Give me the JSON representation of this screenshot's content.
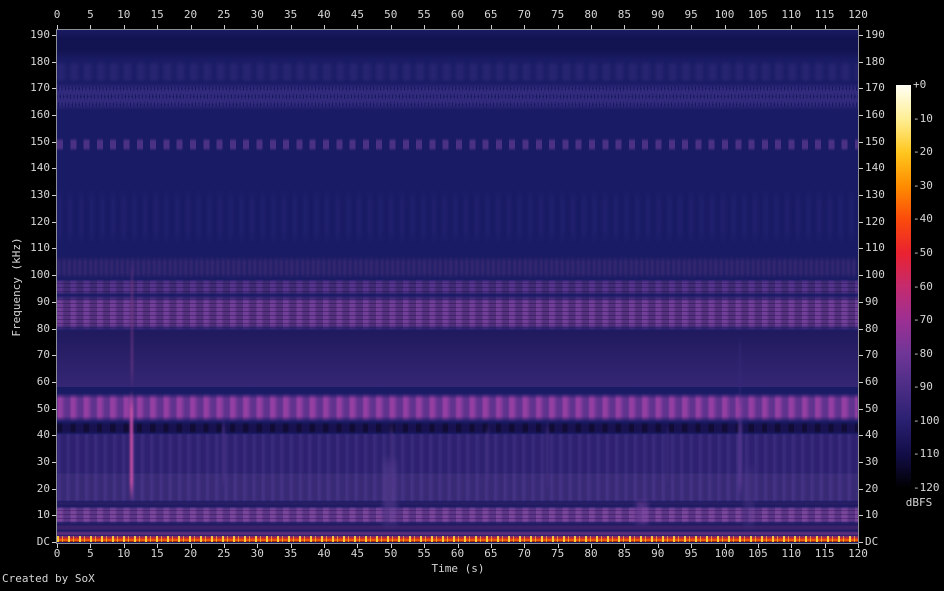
{
  "colors": {
    "page_background": "#000000",
    "plot_background": "#191b64",
    "plot_border": "#8e8e96",
    "tick": "#cfcfcf",
    "label_text": "#d6d6d6"
  },
  "chart_data": {
    "type": "heatmap",
    "subtype": "spectrogram",
    "xlabel": "Time (s)",
    "ylabel": "Frequency (kHz)",
    "credit": "Created by SoX",
    "colorbar_label": "dBFS",
    "x_range_s": [
      0,
      120
    ],
    "x_tick_step_s": 5,
    "y_range_khz": [
      0,
      192
    ],
    "y_tick_step_khz": 10,
    "colorbar_range_db": [
      0,
      -120
    ],
    "x_tick_labels": [
      "0",
      "5",
      "10",
      "15",
      "20",
      "25",
      "30",
      "35",
      "40",
      "45",
      "50",
      "55",
      "60",
      "65",
      "70",
      "75",
      "80",
      "85",
      "90",
      "95",
      "100",
      "105",
      "110",
      "115",
      "120"
    ],
    "y_tick_labels": [
      "190",
      "180",
      "170",
      "160",
      "150",
      "140",
      "130",
      "120",
      "110",
      "100",
      "90",
      "80",
      "70",
      "60",
      "50",
      "40",
      "30",
      "20",
      "10",
      "DC"
    ],
    "colorbar_tick_labels": [
      "+0",
      "-10",
      "-20",
      "-30",
      "-40",
      "-50",
      "-60",
      "-70",
      "-80",
      "-90",
      "-100",
      "-110",
      "-120"
    ],
    "palette_stops": [
      {
        "db": -120,
        "color": "#000000"
      },
      {
        "db": -110,
        "color": "#120d47"
      },
      {
        "db": -100,
        "color": "#2a2071"
      },
      {
        "db": -90,
        "color": "#4b2d85"
      },
      {
        "db": -80,
        "color": "#6f3697"
      },
      {
        "db": -70,
        "color": "#9d2f93"
      },
      {
        "db": -60,
        "color": "#c52b6e"
      },
      {
        "db": -50,
        "color": "#ea2230"
      },
      {
        "db": -40,
        "color": "#fb4b0b"
      },
      {
        "db": -30,
        "color": "#ff8d00"
      },
      {
        "db": -20,
        "color": "#ffc71f"
      },
      {
        "db": -10,
        "color": "#ffef96"
      },
      {
        "db": 0,
        "color": "#fffff5"
      }
    ],
    "bands": [
      {
        "name": "top-fade",
        "f_low": 181,
        "f_high": 192,
        "texture": "smooth",
        "colors": [
          "#12134f"
        ],
        "opacity": 0.9,
        "feather": 30
      },
      {
        "name": "mottle-175khz",
        "f_low": 171.5,
        "f_high": 180.5,
        "texture": "mottle",
        "colors": [
          "#2b2875"
        ],
        "period_s": 2,
        "opacity": 0.85,
        "feather": 25
      },
      {
        "name": "wave-167khz",
        "f_low": 162,
        "f_high": 172,
        "texture": "wave",
        "colors": [
          "#342c80",
          "#0e0e46"
        ],
        "period_s": 1,
        "opacity": 0.9,
        "feather": 20
      },
      {
        "name": "dashes-149khz",
        "f_low": 146.5,
        "f_high": 151.5,
        "texture": "dashes",
        "colors": [
          "#503488"
        ],
        "period_s": 2,
        "opacity": 0.9,
        "feather": 25
      },
      {
        "name": "faintcols-120khz",
        "f_low": 111,
        "f_high": 133,
        "texture": "faintcols",
        "colors": [
          "#262577"
        ],
        "period_s": 1.6,
        "opacity": 0.5,
        "feather": 25
      },
      {
        "name": "fuzz-103khz",
        "f_low": 98.5,
        "f_high": 107,
        "texture": "speckle",
        "colors": [
          "#3c2b73"
        ],
        "period_s": 0.8,
        "opacity": 0.85,
        "feather": 25
      },
      {
        "name": "band-96khz",
        "f_low": 92.5,
        "f_high": 98.5,
        "texture": "blocks",
        "colors": [
          "#452c78",
          "#5a3690"
        ],
        "period_s": 2,
        "opacity": 0.95,
        "feather": 20
      },
      {
        "name": "band-86khz",
        "f_low": 79,
        "f_high": 92.5,
        "texture": "blocks",
        "colors": [
          "#54307f",
          "#713e99"
        ],
        "period_s": 2,
        "opacity": 1,
        "feather": 18
      },
      {
        "name": "grad-70khz",
        "f_low": 58,
        "f_high": 79,
        "texture": "vgrad",
        "colors": [
          "#352674",
          "#201a5e"
        ],
        "opacity": 1,
        "feather": 0
      },
      {
        "name": "band-50khz",
        "f_low": 44.8,
        "f_high": 56,
        "texture": "blobs",
        "colors": [
          "#5f338e",
          "#943fa2"
        ],
        "period_s": 2,
        "opacity": 1,
        "feather": 20
      },
      {
        "name": "dark-43khz",
        "f_low": 40.3,
        "f_high": 44.8,
        "texture": "darkdash",
        "colors": [
          "#181250"
        ],
        "period_s": 2,
        "opacity": 0.95,
        "feather": 25
      },
      {
        "name": "noise-33khz",
        "f_low": 26,
        "f_high": 40.3,
        "texture": "columns",
        "colors": [
          "#2e2270",
          "#3a2b7c"
        ],
        "period_s": 1.4,
        "opacity": 1,
        "feather": 0
      },
      {
        "name": "noise-21khz",
        "f_low": 15.5,
        "f_high": 26,
        "texture": "columns",
        "colors": [
          "#382a75",
          "#443284"
        ],
        "period_s": 1.4,
        "opacity": 1,
        "feather": 0
      },
      {
        "name": "gap-14khz",
        "f_low": 13.5,
        "f_high": 15.5,
        "texture": "smooth",
        "colors": [
          "#2a1e66"
        ],
        "opacity": 1,
        "feather": 40
      },
      {
        "name": "band-10khz",
        "f_low": 6.8,
        "f_high": 13.5,
        "texture": "blocks",
        "colors": [
          "#5c3488",
          "#7a459c"
        ],
        "period_s": 2,
        "opacity": 1,
        "feather": 18
      },
      {
        "name": "purple-5khz",
        "f_low": 4.2,
        "f_high": 6.8,
        "texture": "smooth",
        "colors": [
          "#3b2269"
        ],
        "opacity": 1,
        "feather": 35
      },
      {
        "name": "glow-3khz",
        "f_low": 2.1,
        "f_high": 4.2,
        "texture": "smooth",
        "colors": [
          "#5c2d7c"
        ],
        "opacity": 1,
        "feather": 35
      },
      {
        "name": "dc-line",
        "f_low": 0,
        "f_high": 2.1,
        "texture": "dc",
        "colors": [
          "#8c2f86",
          "#d02a20",
          "#ff6f07",
          "#ffd83c"
        ],
        "opacity": 1,
        "feather": 0
      }
    ],
    "events": [
      {
        "name": "impulse-11s",
        "t": 11.2,
        "f_low": 15,
        "f_high": 57,
        "width_s": 0.45,
        "color": "#d252aa",
        "opacity": 0.95,
        "blur": 1
      },
      {
        "name": "impulse-11s-upper",
        "t": 11.2,
        "f_low": 57,
        "f_high": 105,
        "width_s": 0.3,
        "color": "#a84a9a",
        "opacity": 0.45,
        "blur": 1
      },
      {
        "name": "streak-25s",
        "t": 24.9,
        "f_low": 20,
        "f_high": 47,
        "width_s": 0.5,
        "color": "#52368c",
        "opacity": 0.6,
        "blur": 1
      },
      {
        "name": "broad-50s",
        "t": 49.9,
        "f_low": 4,
        "f_high": 33,
        "width_s": 2.2,
        "color": "#5b3f92",
        "opacity": 0.5,
        "blur": 2
      },
      {
        "name": "streak-50s",
        "t": 50.1,
        "f_low": 20,
        "f_high": 46,
        "width_s": 0.5,
        "color": "#4c3384",
        "opacity": 0.5,
        "blur": 1
      },
      {
        "name": "streak-64s",
        "t": 64.5,
        "f_low": 20,
        "f_high": 45,
        "width_s": 0.4,
        "color": "#483083",
        "opacity": 0.5,
        "blur": 1
      },
      {
        "name": "streak-73s",
        "t": 73.5,
        "f_low": 18,
        "f_high": 46,
        "width_s": 0.5,
        "color": "#4b3387",
        "opacity": 0.5,
        "blur": 1
      },
      {
        "name": "blob-87s",
        "t": 87.6,
        "f_low": 6,
        "f_high": 16,
        "width_s": 1.8,
        "color": "#7c46a2",
        "opacity": 0.5,
        "blur": 2
      },
      {
        "name": "streak-91s",
        "t": 91.5,
        "f_low": 20,
        "f_high": 44,
        "width_s": 0.4,
        "color": "#453181",
        "opacity": 0.45,
        "blur": 1
      },
      {
        "name": "streak-102s",
        "t": 102.3,
        "f_low": 17,
        "f_high": 49,
        "width_s": 0.6,
        "color": "#5c3b96",
        "opacity": 0.7,
        "blur": 1
      },
      {
        "name": "streak-102s-upper",
        "t": 102.3,
        "f_low": 49,
        "f_high": 78,
        "width_s": 0.3,
        "color": "#3b2d7e",
        "opacity": 0.5,
        "blur": 1
      },
      {
        "name": "broad-103s",
        "t": 103.6,
        "f_low": 3,
        "f_high": 30,
        "width_s": 1.5,
        "color": "#4b3686",
        "opacity": 0.4,
        "blur": 2
      }
    ]
  }
}
